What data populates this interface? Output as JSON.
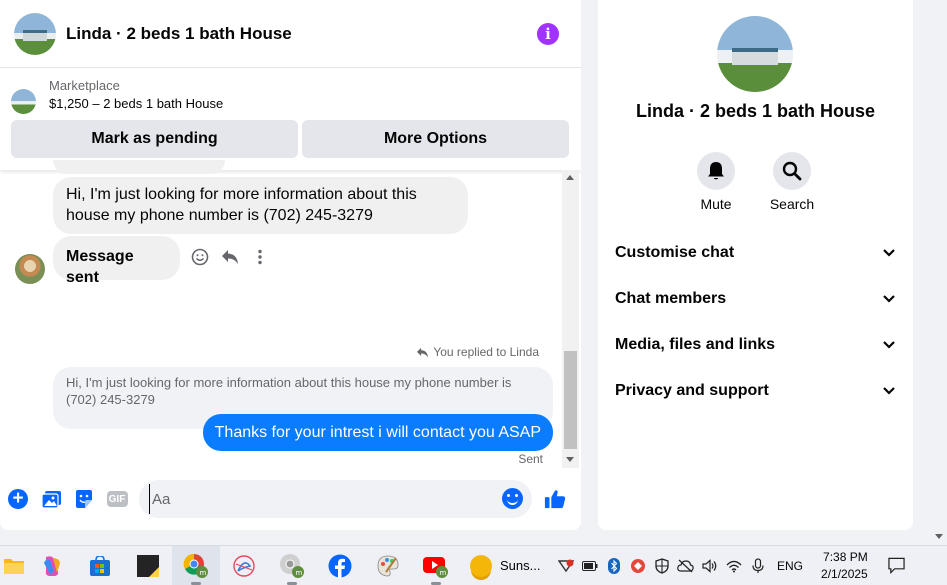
{
  "chat": {
    "title": "Linda · 2 beds 1 bath House",
    "listing": {
      "source": "Marketplace",
      "price_title": "$1,250 – 2 beds 1 bath House",
      "mark_pending_label": "Mark as pending",
      "more_options_label": "More Options"
    },
    "messages": {
      "incoming_1": "Hi, I'm just looking for more information about this house my phone number is (702) 245-3279",
      "incoming_2": "Message sent",
      "replied_note": "You replied to Linda",
      "quoted": "Hi, I'm just looking for more information about this house my phone number is (702) 245-3279",
      "outgoing": "Thanks for your intrest i will contact you ASAP",
      "status": "Sent"
    },
    "composer": {
      "placeholder": "Aa",
      "gif_label": "GIF"
    }
  },
  "details": {
    "name": "Linda · 2 beds 1 bath House",
    "actions": [
      {
        "label": "Mute",
        "icon": "bell-icon"
      },
      {
        "label": "Search",
        "icon": "search-icon"
      }
    ],
    "sections": [
      {
        "label": "Customise chat"
      },
      {
        "label": "Chat members"
      },
      {
        "label": "Media, files and links"
      },
      {
        "label": "Privacy and support"
      }
    ]
  },
  "taskbar": {
    "weather_label": "Suns...",
    "language": "ENG",
    "time": "7:38 PM",
    "date": "2/1/2025"
  },
  "colors": {
    "accent_blue": "#0866ff",
    "bubble_blue": "#0a7cff",
    "info_purple": "#a033ff"
  }
}
